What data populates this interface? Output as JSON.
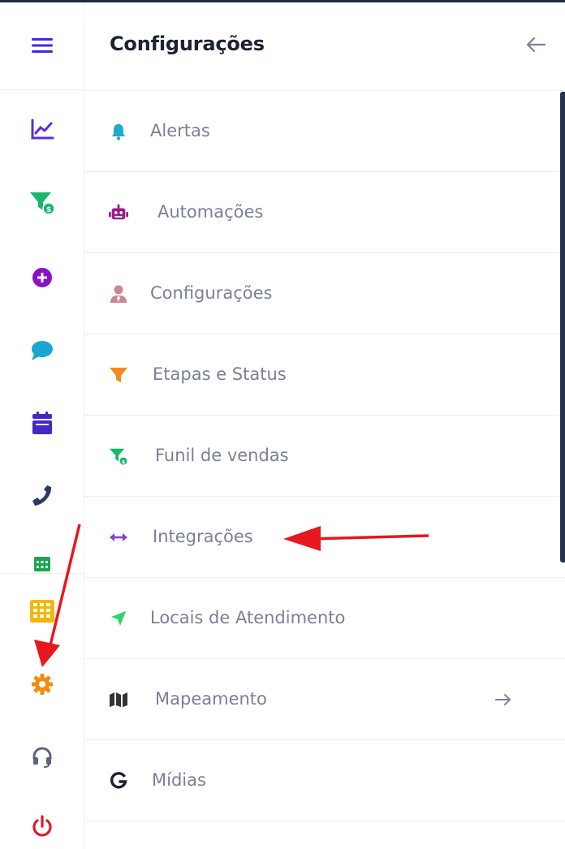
{
  "panel": {
    "title": "Configurações",
    "back_icon": "arrow-left-icon"
  },
  "rail": {
    "items": [
      {
        "icon": "menu-hamburger-icon",
        "color": "#3b2cde"
      },
      {
        "icon": "chart-line-icon",
        "color": "#5b2fd8"
      },
      {
        "icon": "funnel-dollar-icon",
        "color": "#17b86b"
      },
      {
        "icon": "plus-circle-icon",
        "color": "#8a12c4"
      },
      {
        "icon": "chat-bubble-icon",
        "color": "#19a6d4"
      },
      {
        "icon": "calendar-icon",
        "color": "#4526c9"
      },
      {
        "icon": "phone-icon",
        "color": "#2b3a63"
      },
      {
        "icon": "table-small-icon",
        "color": "#1aa64e"
      },
      {
        "icon": "table-grid-icon",
        "color": "#f2b705"
      },
      {
        "icon": "gear-icon",
        "color": "#f28c12"
      },
      {
        "icon": "headset-icon",
        "color": "#5c6380"
      },
      {
        "icon": "power-icon",
        "color": "#e0192b"
      }
    ]
  },
  "menu": {
    "items": [
      {
        "label": "Alertas",
        "icon": "bell-icon",
        "color": "#1faad1"
      },
      {
        "label": "Automações",
        "icon": "robot-icon",
        "color": "#9b1d8c"
      },
      {
        "label": "Configurações",
        "icon": "user-tie-icon",
        "color": "#c9878f"
      },
      {
        "label": "Etapas e Status",
        "icon": "filter-icon",
        "color": "#f5881f"
      },
      {
        "label": "Funil de vendas",
        "icon": "funnel-dollar-icon",
        "color": "#17b86b"
      },
      {
        "label": "Integrações",
        "icon": "arrows-horizontal-icon",
        "color": "#8a3fd1"
      },
      {
        "label": "Locais de Atendimento",
        "icon": "location-arrow-icon",
        "color": "#2ed36a"
      },
      {
        "label": "Mapeamento",
        "icon": "map-icon",
        "color": "#333333",
        "has_submenu": true
      },
      {
        "label": "Mídias",
        "icon": "google-g-icon",
        "color": "#1b2232"
      }
    ],
    "submenu_icon": "arrow-right-icon"
  },
  "annotations": {
    "arrow_color": "#e8171f"
  }
}
